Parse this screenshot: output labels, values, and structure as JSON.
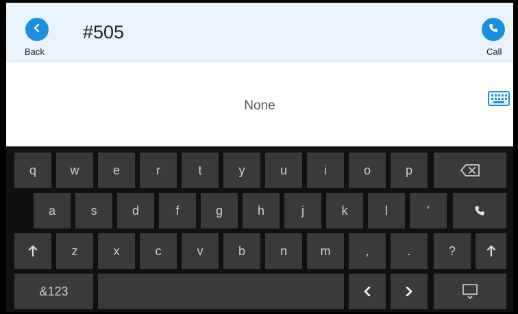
{
  "header": {
    "back_label": "Back",
    "call_label": "Call",
    "dial_number": "#505"
  },
  "results": {
    "text": "None"
  },
  "keyboard": {
    "row1": [
      "q",
      "w",
      "e",
      "r",
      "t",
      "y",
      "u",
      "i",
      "o",
      "p"
    ],
    "row2": [
      "a",
      "s",
      "d",
      "f",
      "g",
      "h",
      "j",
      "k",
      "l",
      "'"
    ],
    "row3": [
      "z",
      "x",
      "c",
      "v",
      "b",
      "n",
      "m",
      ",",
      ".",
      "?"
    ],
    "mode_label": "&123"
  },
  "colors": {
    "accent": "#1a8fe0",
    "header_bg": "#e8f3fb",
    "key_bg": "#3a3a3a",
    "keyboard_bg": "#111111"
  },
  "icons": {
    "back": "chevron-left-icon",
    "call": "phone-icon",
    "keyboard": "keyboard-icon",
    "backspace": "backspace-icon",
    "shift": "arrow-up-icon",
    "left": "chevron-left-icon",
    "right": "chevron-right-icon",
    "hide": "hide-keyboard-icon"
  }
}
